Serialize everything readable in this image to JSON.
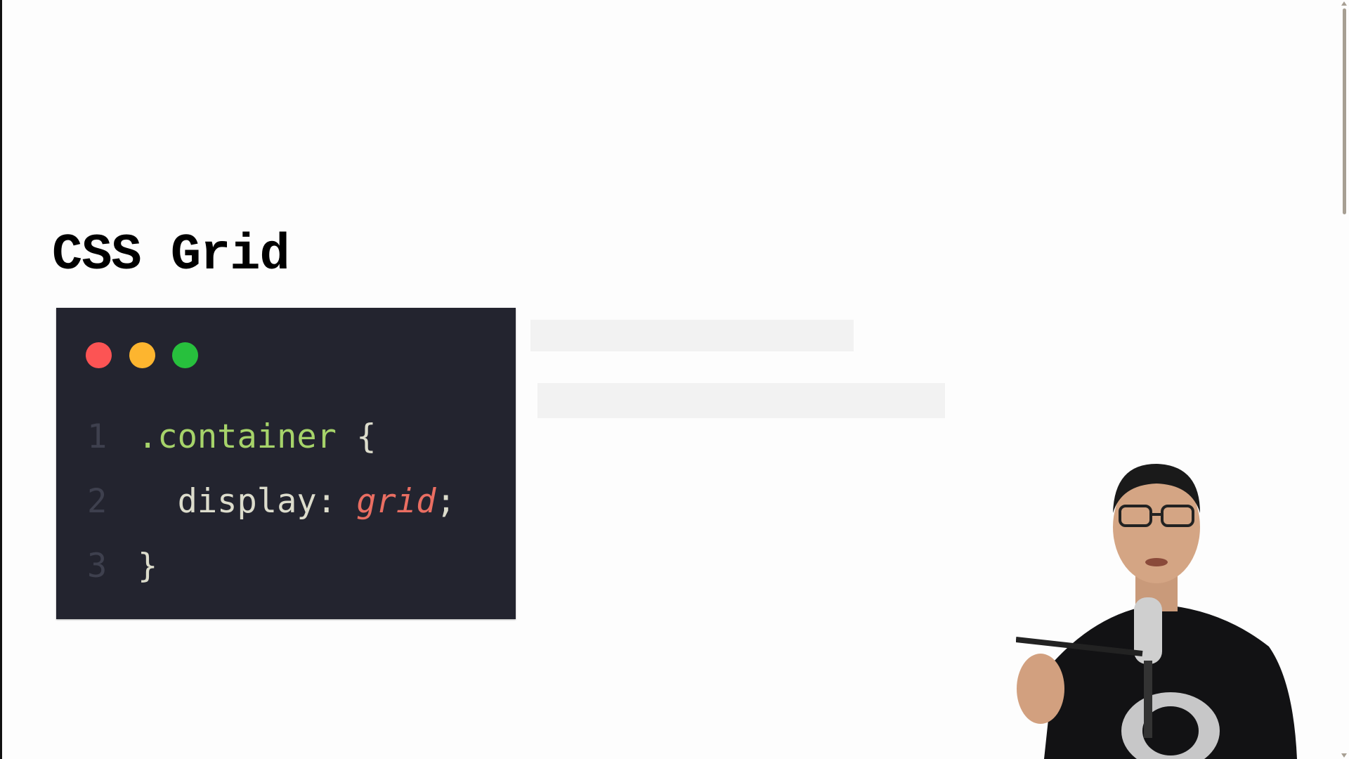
{
  "slide": {
    "title": "CSS Grid"
  },
  "code_window": {
    "window_dots": [
      "#fc5454",
      "#fdb52f",
      "#27c03d"
    ],
    "lines": [
      {
        "number": "1",
        "selector": ".container",
        "open": " {"
      },
      {
        "number": "2",
        "indent": "  ",
        "property": "display",
        "colon": ": ",
        "value": "grid",
        "semicolon": ";"
      },
      {
        "number": "3",
        "close": "}"
      }
    ]
  },
  "colors": {
    "code_background": "#23242f",
    "selector": "#a6d36a",
    "value": "#ea6e62",
    "line_number": "#3e404e"
  },
  "scrollbar": {
    "position_percent": 0
  },
  "icons": {
    "webcam": "presenter-webcam-overlay"
  }
}
